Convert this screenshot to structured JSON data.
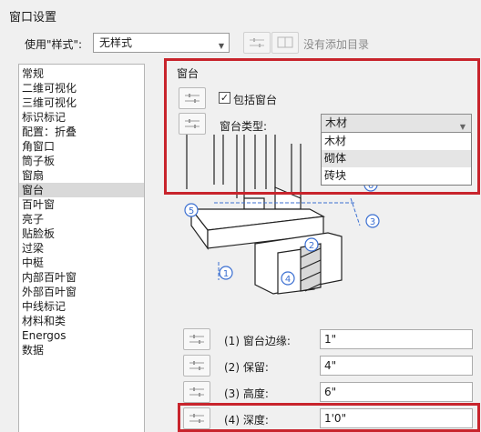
{
  "dialog": {
    "title": "窗口设置",
    "style_label": "使用\"样式\":",
    "style_value": "无样式",
    "catalog_text": "没有添加目录"
  },
  "icons": {
    "settings": "sliders-icon",
    "catalog": "book-icon"
  },
  "left_list": {
    "items": [
      "常规",
      "二维可视化",
      "三维可视化",
      "标识标记",
      "配置：折叠",
      "角窗口",
      "筒子板",
      "窗扇",
      "窗台",
      "百叶窗",
      "亮子",
      "贴脸板",
      "过梁",
      "中梃",
      "内部百叶窗",
      "外部百叶窗",
      "中线标记",
      "材料和类",
      "Energos",
      "数据"
    ],
    "selected_index": 8
  },
  "sill": {
    "group_title": "窗台",
    "include_label": "包括窗台",
    "include_checked": true,
    "type_label": "窗台类型:",
    "type_value": "木材",
    "type_options": [
      "木材",
      "砌体",
      "砖块"
    ],
    "highlighted_option": 1
  },
  "diagram": {
    "callouts": [
      "1",
      "2",
      "3",
      "4",
      "5",
      "6"
    ]
  },
  "params": [
    {
      "label": "(1) 窗台边缘:",
      "value": "1\""
    },
    {
      "label": "(2) 保留:",
      "value": "4\""
    },
    {
      "label": "(3) 高度:",
      "value": "6\""
    },
    {
      "label": "(4) 深度:",
      "value": "1'0\""
    }
  ],
  "colors": {
    "highlight_box": "#c8242c",
    "callout": "#3b6fd1"
  }
}
